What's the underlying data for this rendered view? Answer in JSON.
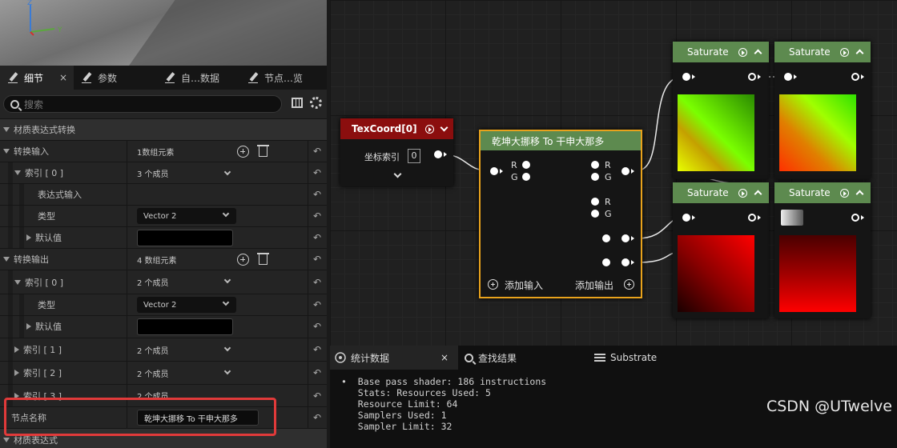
{
  "viewport": {
    "axis_z": "Z",
    "axis_y": "Y",
    "axis_x": "X"
  },
  "details_tabs": [
    {
      "label": "细节",
      "close": "×"
    },
    {
      "label": "参数"
    },
    {
      "label": "自…数据"
    },
    {
      "label": "节点…览"
    }
  ],
  "search": {
    "placeholder": "搜索"
  },
  "sections": {
    "material_expression_transform": "材质表达式转换",
    "material_expression": "材质表达式"
  },
  "props": {
    "transform_input": {
      "label": "转换输入",
      "value": "1数组元素"
    },
    "input_index0": {
      "label": "索引 [ 0 ]",
      "value": "3 个成员"
    },
    "expression_input": {
      "label": "表达式输入"
    },
    "type1": {
      "label": "类型",
      "value": "Vector 2"
    },
    "default1": {
      "label": "默认值"
    },
    "transform_output": {
      "label": "转换输出",
      "value": "4 数组元素"
    },
    "output_index0": {
      "label": "索引 [ 0 ]",
      "value": "2 个成员"
    },
    "type2": {
      "label": "类型",
      "value": "Vector 2"
    },
    "default2": {
      "label": "默认值"
    },
    "output_index1": {
      "label": "索引 [ 1 ]",
      "value": "2 个成员"
    },
    "output_index2": {
      "label": "索引 [ 2 ]",
      "value": "2 个成员"
    },
    "output_index3": {
      "label": "索引 [ 3 ]",
      "value": "2 个成员"
    },
    "node_name": {
      "label": "节点名称",
      "value": "乾坤大挪移 To 干申大那多"
    },
    "reset_symbol": "↶"
  },
  "graph": {
    "texcoord": {
      "title": "TexCoord[0]",
      "pin_label": "坐标索引",
      "index_value": "0"
    },
    "transform_node": {
      "title": "乾坤大挪移 To 干申大那多",
      "in_r": "R",
      "in_g": "G",
      "out1_r": "R",
      "out1_g": "G",
      "out2_r": "R",
      "out2_g": "G",
      "add_input": "添加输入",
      "add_output": "添加输出"
    },
    "saturate_title": "Saturate",
    "colors": {
      "saturate_header": "#5d8a4f",
      "texcoord_header": "#8b0e0e",
      "selected_border": "#e8a21c"
    }
  },
  "stats_tabs": [
    {
      "label": "统计数据",
      "close": "×"
    },
    {
      "label": "查找结果"
    },
    {
      "label": "Substrate"
    }
  ],
  "stats_lines": [
    "•  Base pass shader: 186 instructions",
    "   Stats: Resources Used: 5",
    "   Resource Limit: 64",
    "   Samplers Used: 1",
    "   Sampler Limit: 32"
  ],
  "watermark": "CSDN @UTwelve"
}
